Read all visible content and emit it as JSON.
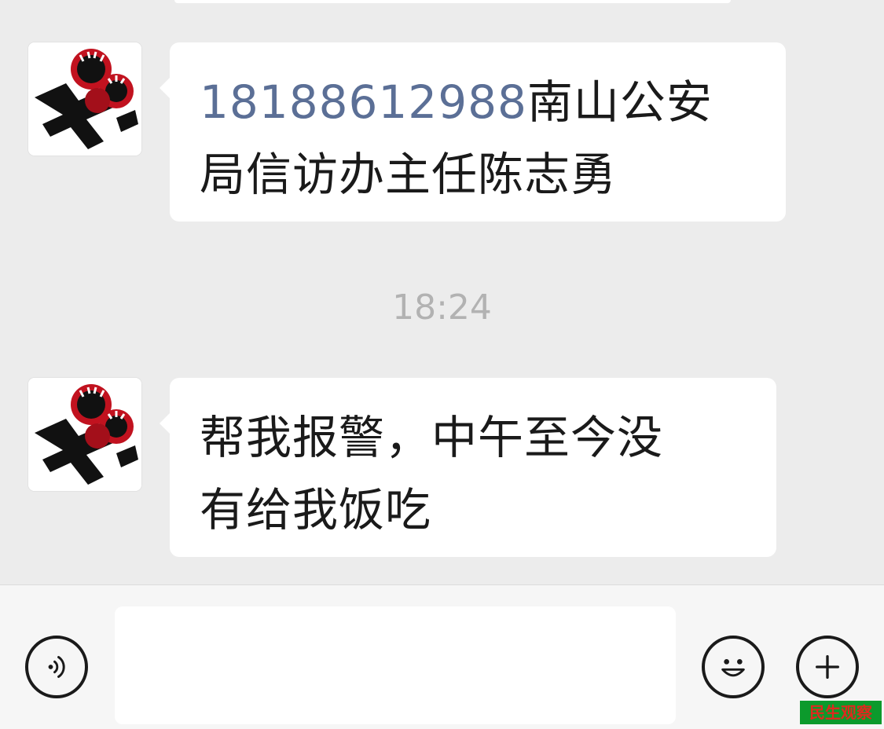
{
  "chat": {
    "messages": [
      {
        "sender": "incoming",
        "phone": "18188612988",
        "line1_rest": "南山公安",
        "line2": "局信访办主任陈志勇"
      },
      {
        "sender": "incoming",
        "line1": "帮我报警，中午至今没",
        "line2": "有给我饭吃"
      }
    ],
    "timestamp": "18:24"
  },
  "input_bar": {
    "voice_icon": "voice-icon",
    "emoji_icon": "emoji-icon",
    "plus_icon": "plus-icon",
    "input_value": ""
  },
  "watermark": {
    "text": "民生观察"
  },
  "colors": {
    "background": "#ececec",
    "bubble": "#ffffff",
    "link": "#5b6f96",
    "timestamp": "#b2b2b2",
    "watermark_bg": "#0c9a2c",
    "watermark_text": "#e0281e"
  }
}
